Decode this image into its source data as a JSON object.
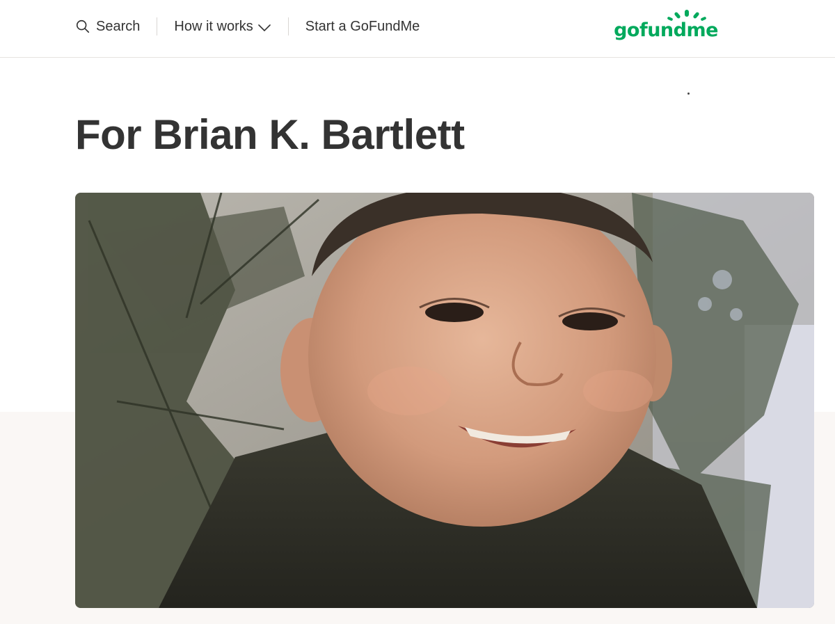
{
  "header": {
    "search_label": "Search",
    "how_it_works_label": "How it works",
    "start_label": "Start a GoFundMe",
    "logo_text": "gofundme",
    "brand_color": "#02a95c"
  },
  "campaign": {
    "title": "For Brian K. Bartlett"
  },
  "icons": {
    "search": "search-icon",
    "dropdown": "chevron-down-icon",
    "logo": "gofundme-logo"
  }
}
